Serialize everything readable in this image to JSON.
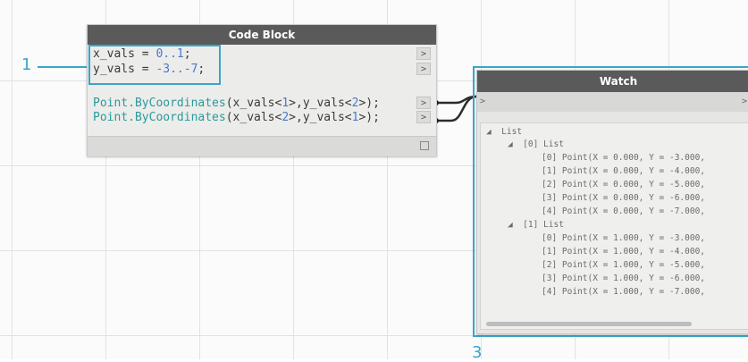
{
  "code_block": {
    "title": "Code Block",
    "lines": [
      {
        "pre": "x_vals = ",
        "num": "0..1",
        "post": ";"
      },
      {
        "pre": "y_vals = ",
        "num": "-3..-7",
        "post": ";"
      }
    ],
    "point_lines": [
      {
        "kw": "Point.ByCoordinates",
        "a": "(x_vals<",
        "n1": "1",
        "b": ">,y_vals<",
        "n2": "2",
        "c": ">);"
      },
      {
        "kw": "Point.ByCoordinates",
        "a": "(x_vals<",
        "n1": "2",
        "b": ">,y_vals<",
        "n2": "1",
        "c": ">);"
      }
    ],
    "port_glyph": ">"
  },
  "annotations": {
    "callout_1": "1",
    "callout_3": "3"
  },
  "watch": {
    "title": "Watch",
    "in_port": ">",
    "out_port": ">",
    "tree": [
      {
        "text": "◢  List"
      },
      {
        "text": "◢  [0] List"
      },
      {
        "text": "[0] Point(X = 0.000, Y = -3.000,"
      },
      {
        "text": "[1] Point(X = 0.000, Y = -4.000,"
      },
      {
        "text": "[2] Point(X = 0.000, Y = -5.000,"
      },
      {
        "text": "[3] Point(X = 0.000, Y = -6.000,"
      },
      {
        "text": "[4] Point(X = 0.000, Y = -7.000,"
      },
      {
        "text": "◢  [1] List"
      },
      {
        "text": "[0] Point(X = 1.000, Y = -3.000,"
      },
      {
        "text": "[1] Point(X = 1.000, Y = -4.000,"
      },
      {
        "text": "[2] Point(X = 1.000, Y = -5.000,"
      },
      {
        "text": "[3] Point(X = 1.000, Y = -6.000,"
      },
      {
        "text": "[4] Point(X = 1.000, Y = -7.000,"
      }
    ]
  },
  "colors": {
    "accent": "#3aa6c8",
    "header": "#5a5a5a"
  }
}
